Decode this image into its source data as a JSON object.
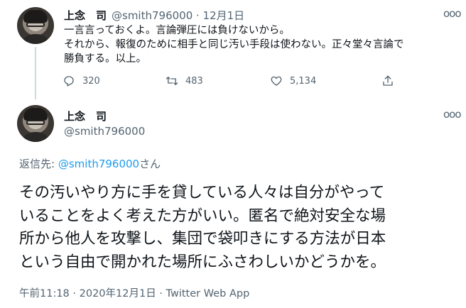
{
  "parent_tweet": {
    "author_name": "上念　司",
    "handle_and_date": "@smith796000 · 12月1日",
    "more": "ooo",
    "lines": [
      "一言言っておくよ。言論弾圧には負けないから。",
      "それから、報復のために相手と同じ汚い手段は使わない。正々堂々言論で",
      "勝負する。以上。"
    ],
    "actions": {
      "reply_count": "320",
      "retweet_count": "483",
      "like_count": "5,134"
    }
  },
  "main_tweet": {
    "author_name": "上念　司",
    "handle": "@smith796000",
    "more": "ooo",
    "reply_to_label": "返信先:",
    "reply_to_handle": "@smith796000",
    "reply_to_suffix": "さん",
    "lines": [
      "その汚いやり方に手を貸している人々は自分がやって",
      "いることをよく考えた方がいい。匿名で絶対安全な場",
      "所から他人を攻撃し、集団で袋叩きにする方法が日本",
      "という自由で開かれた場所にふさわしいかどうかを。"
    ],
    "meta": "午前11:18 · 2020年12月1日 · Twitter Web App"
  },
  "icons": {
    "reply": "reply-icon",
    "retweet": "retweet-icon",
    "like": "heart-icon",
    "share": "share-icon"
  }
}
